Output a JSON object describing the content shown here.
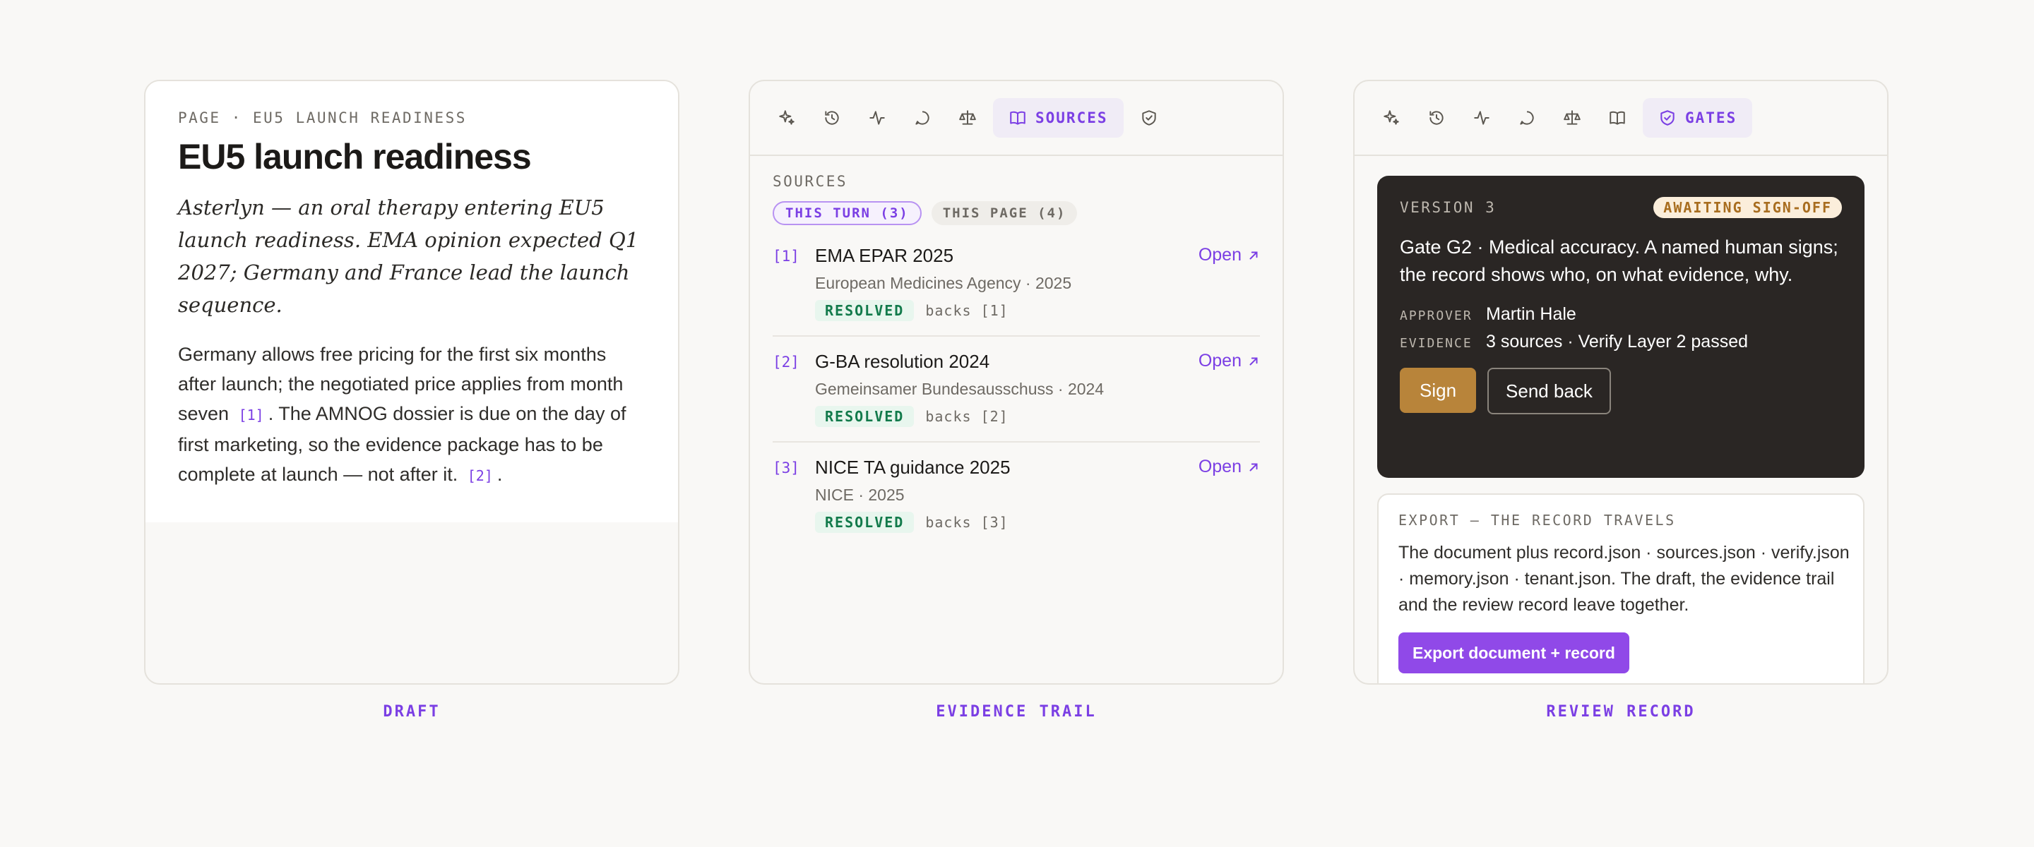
{
  "draft": {
    "eyebrow": "PAGE · EU5 LAUNCH READINESS",
    "title": "EU5 launch readiness",
    "lede": "Asterlyn — an oral therapy entering EU5 launch readiness. EMA opinion expected Q1 2027; Germany and France lead the launch sequence.",
    "para_part1": "Germany allows free pricing for the first six months after launch; the negotiated price applies from month seven",
    "cite1": "[1]",
    "para_part2": ". The AMNOG dossier is due on the day of first marketing, so the evidence package has to be complete at launch — not after it.",
    "cite2": "[2]",
    "para_end": ".",
    "caption": "DRAFT"
  },
  "evidence": {
    "toolbar": {
      "icons": [
        "sparkles-icon",
        "history-icon",
        "activity-icon",
        "chat-icon",
        "scales-icon",
        "book-icon",
        "shield-check-icon"
      ],
      "active_label": "SOURCES"
    },
    "heading": "SOURCES",
    "chips": {
      "this_turn": "THIS TURN (3)",
      "this_page": "THIS PAGE (4)"
    },
    "sources": [
      {
        "num": "[1]",
        "title": "EMA EPAR 2025",
        "meta": "European Medicines Agency · 2025",
        "status": "RESOLVED",
        "backs": "backs [1]",
        "open": "Open"
      },
      {
        "num": "[2]",
        "title": "G-BA resolution 2024",
        "meta": "Gemeinsamer Bundesausschuss · 2024",
        "status": "RESOLVED",
        "backs": "backs [2]",
        "open": "Open"
      },
      {
        "num": "[3]",
        "title": "NICE TA guidance 2025",
        "meta": "NICE · 2025",
        "status": "RESOLVED",
        "backs": "backs [3]",
        "open": "Open"
      }
    ],
    "caption": "EVIDENCE TRAIL"
  },
  "review": {
    "toolbar": {
      "icons": [
        "sparkles-icon",
        "history-icon",
        "activity-icon",
        "chat-icon",
        "scales-icon",
        "book-icon",
        "shield-check-icon"
      ],
      "active_label": "GATES"
    },
    "gate": {
      "version": "VERSION 3",
      "badge": "AWAITING SIGN-OFF",
      "text": "Gate G2 · Medical accuracy. A named human signs; the record shows who, on what evidence, why.",
      "approver_key": "APPROVER",
      "approver_val": "Martin Hale",
      "evidence_key": "EVIDENCE",
      "evidence_val": "3 sources · Verify Layer 2 passed",
      "sign": "Sign",
      "send_back": "Send back"
    },
    "export": {
      "heading": "EXPORT — THE RECORD TRAVELS",
      "text": "The document plus record.json · sources.json · verify.json · memory.json · tenant.json. The draft, the evidence trail and the review record leave together.",
      "button": "Export document + record"
    },
    "caption": "REVIEW RECORD"
  },
  "colors": {
    "accent": "#7b3fe4",
    "background": "#f9f8f6",
    "gate_card": "#2a2624",
    "sign_button": "#b8843a",
    "resolved_text": "#127a4b",
    "awaiting_text": "#a86d1f"
  }
}
